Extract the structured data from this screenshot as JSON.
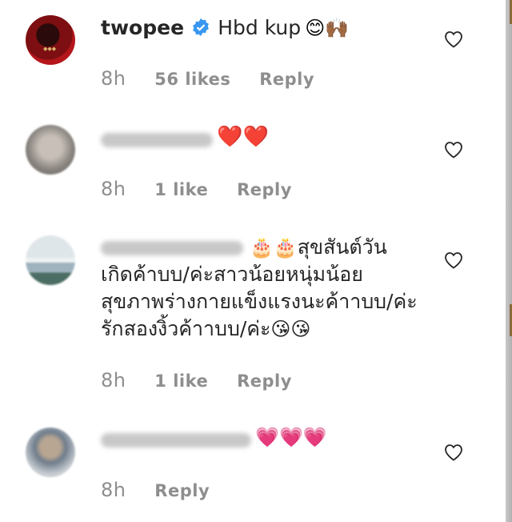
{
  "comments": [
    {
      "username": "twopee",
      "verified": true,
      "text": "Hbd kup",
      "emojis": "😊🙌🏾",
      "time": "8h",
      "likes": "56 likes",
      "reply": "Reply"
    },
    {
      "username": "",
      "text": "",
      "emojis": "❤️❤️",
      "time": "8h",
      "likes": "1 like",
      "reply": "Reply"
    },
    {
      "username": "",
      "emojis_lead": "🎂🎂",
      "text_lines": [
        "สุขสันต์วัน",
        "เกิดค้าบบ/ค่ะสาวน้อยหนุ่มน้อย",
        "สุขภาพร่างกายแข็งแรงนะค้าาบบ/ค่ะ",
        "รักสองงิ้วค้าาบบ/ค่ะ"
      ],
      "emojis_tail": "😘😘",
      "time": "8h",
      "likes": "1 like",
      "reply": "Reply"
    },
    {
      "username": "",
      "emojis": "💗💗💗",
      "time": "8h",
      "likes": "",
      "reply": "Reply"
    }
  ],
  "icons": {
    "like": "heart-outline-icon",
    "verified": "verified-badge-icon"
  },
  "colors": {
    "text": "#262626",
    "meta": "#8e8e8e",
    "verified": "#3897f0"
  }
}
